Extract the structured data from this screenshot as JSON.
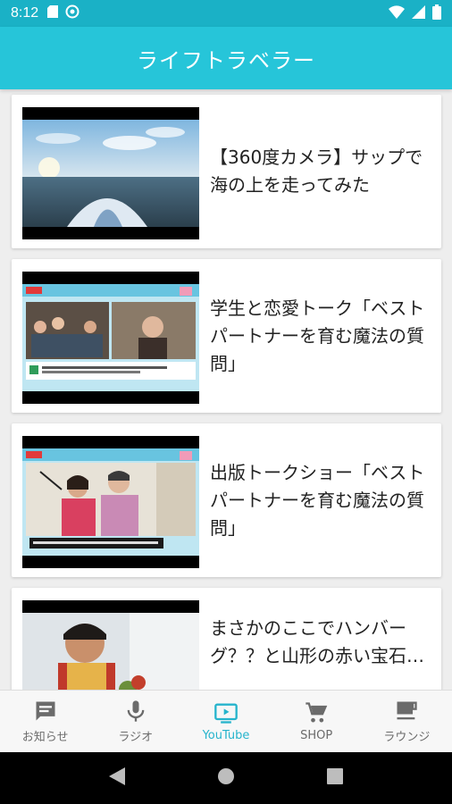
{
  "status_bar": {
    "time": "8:12"
  },
  "app_bar": {
    "title": "ライフトラベラー"
  },
  "videos": [
    {
      "title": "【360度カメラ】サップで海の上を走ってみた"
    },
    {
      "title": "学生と恋愛トーク「ベストパートナーを育む魔法の質問」"
    },
    {
      "title": "出版トークショー「ベストパートナーを育む魔法の質問」"
    },
    {
      "title": "まさかのここでハンバーグ？？と山形の赤い宝石…"
    }
  ],
  "bottom_nav": {
    "items": [
      {
        "label": "お知らせ",
        "icon": "message-icon"
      },
      {
        "label": "ラジオ",
        "icon": "microphone-icon"
      },
      {
        "label": "YouTube",
        "icon": "tv-icon"
      },
      {
        "label": "SHOP",
        "icon": "cart-icon"
      },
      {
        "label": "ラウンジ",
        "icon": "coffee-cup-icon"
      }
    ],
    "active_index": 2
  },
  "colors": {
    "status_bar": "#1ab1c6",
    "app_bar": "#26c5d9",
    "nav_active": "#26b4cc",
    "nav_inactive": "#6b6b6b"
  }
}
